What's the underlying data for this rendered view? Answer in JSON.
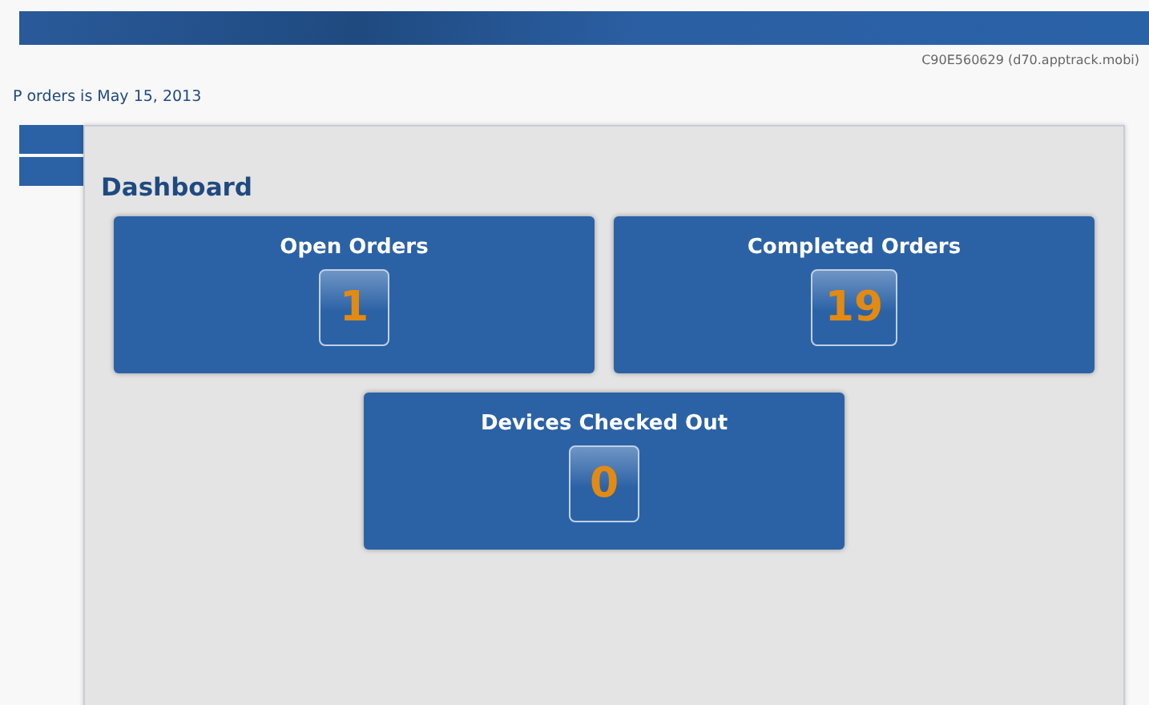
{
  "header": {
    "device_id": "C90E560629 (d70.apptrack.mobi)",
    "notice": "P orders is May 15, 2013"
  },
  "dashboard": {
    "title": "Dashboard",
    "tiles": [
      {
        "label": "Open Orders",
        "count": "1"
      },
      {
        "label": "Completed Orders",
        "count": "19"
      },
      {
        "label": "Devices Checked Out",
        "count": "0"
      }
    ]
  }
}
